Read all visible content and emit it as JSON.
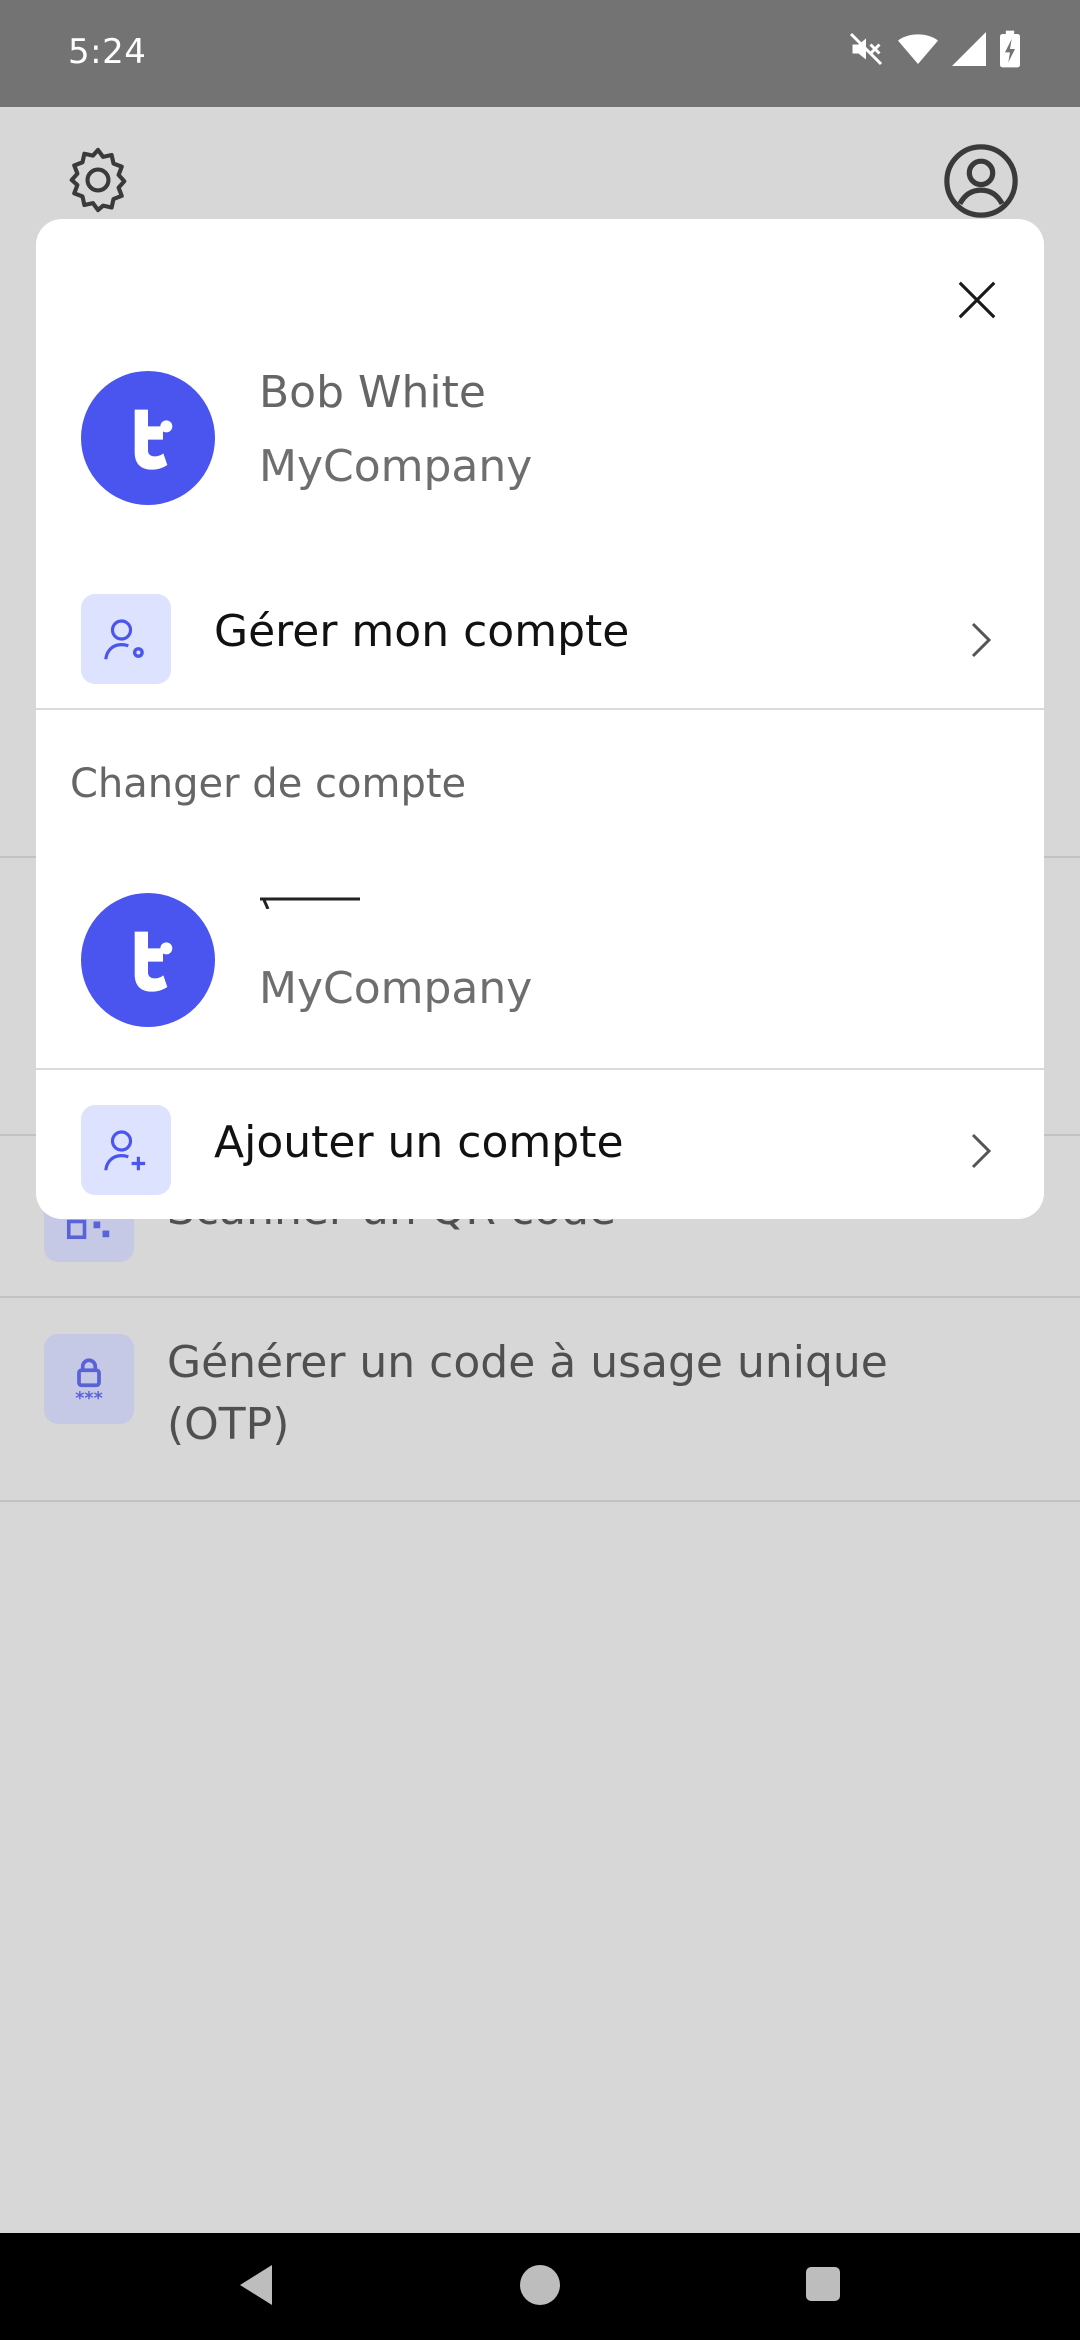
{
  "status_bar": {
    "time": "5:24",
    "icons": [
      "mute-icon",
      "wifi-icon",
      "signal-icon",
      "battery-charging-icon"
    ]
  },
  "background": {
    "rows": [
      {
        "label": "Scanner un QR code",
        "icon": "qr-code-icon"
      },
      {
        "label_line1": "Générer un code à usage unique",
        "label_line2": "(OTP)",
        "icon": "otp-lock-icon"
      }
    ]
  },
  "modal": {
    "current_account": {
      "name": "Bob White",
      "company": "MyCompany"
    },
    "manage_account_label": "Gérer mon compte",
    "switch_section_title": "Changer de compte",
    "other_account": {
      "company": "MyCompany"
    },
    "add_account_label": "Ajouter un compte"
  },
  "colors": {
    "accent": "#4a54ee",
    "icon_tile": "#dde2ff",
    "status_bar": "#737373",
    "backdrop": "#d7d7d7"
  }
}
